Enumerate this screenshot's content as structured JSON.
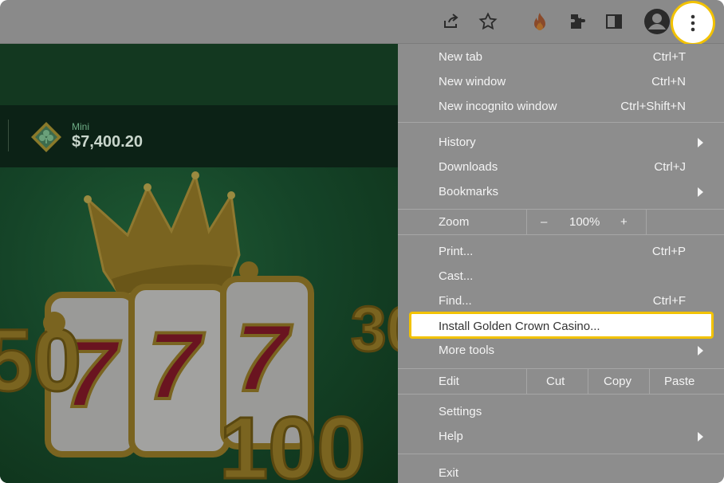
{
  "browser": {
    "toolbar_icons": [
      "share-icon",
      "star-icon",
      "fire-extension-icon",
      "puzzle-extensions-icon",
      "side-panel-icon",
      "profile-avatar-icon",
      "more-menu-kebab-icon"
    ]
  },
  "page": {
    "jackpot": {
      "label": "Mini",
      "value": "$7,400.20"
    }
  },
  "menu": {
    "new_tab": {
      "label": "New tab",
      "shortcut": "Ctrl+T"
    },
    "new_window": {
      "label": "New window",
      "shortcut": "Ctrl+N"
    },
    "new_incognito": {
      "label": "New incognito window",
      "shortcut": "Ctrl+Shift+N"
    },
    "history": {
      "label": "History"
    },
    "downloads": {
      "label": "Downloads",
      "shortcut": "Ctrl+J"
    },
    "bookmarks": {
      "label": "Bookmarks"
    },
    "zoom": {
      "label": "Zoom",
      "minus": "–",
      "level": "100%",
      "plus": "+"
    },
    "print": {
      "label": "Print...",
      "shortcut": "Ctrl+P"
    },
    "cast": {
      "label": "Cast..."
    },
    "find": {
      "label": "Find...",
      "shortcut": "Ctrl+F"
    },
    "install": {
      "label": "Install Golden Crown Casino..."
    },
    "more_tools": {
      "label": "More tools"
    },
    "edit": {
      "label": "Edit",
      "cut": "Cut",
      "copy": "Copy",
      "paste": "Paste"
    },
    "settings": {
      "label": "Settings"
    },
    "help": {
      "label": "Help"
    },
    "exit": {
      "label": "Exit"
    }
  },
  "colors": {
    "highlight_border": "#f2c200",
    "overlay_gray": "#8d8d8d"
  }
}
